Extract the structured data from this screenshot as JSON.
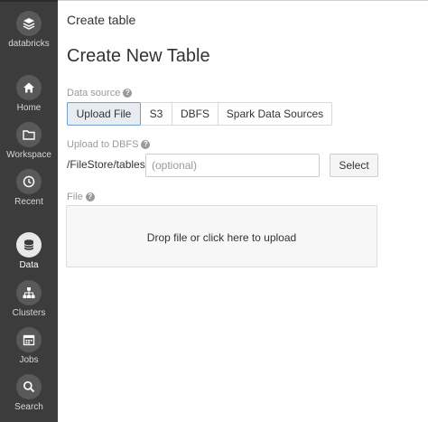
{
  "sidebar": {
    "brand": {
      "label": "databricks",
      "icon": "databricks-logo-icon"
    },
    "items": [
      {
        "label": "Home",
        "icon": "home-icon"
      },
      {
        "label": "Workspace",
        "icon": "folder-icon"
      },
      {
        "label": "Recent",
        "icon": "clock-icon"
      },
      {
        "label": "Data",
        "icon": "database-icon",
        "active": true
      },
      {
        "label": "Clusters",
        "icon": "clusters-icon"
      },
      {
        "label": "Jobs",
        "icon": "calendar-icon"
      },
      {
        "label": "Search",
        "icon": "search-icon"
      }
    ]
  },
  "main": {
    "page_title": "Create table",
    "heading": "Create New Table",
    "data_source": {
      "label": "Data source",
      "options": [
        "Upload File",
        "S3",
        "DBFS",
        "Spark Data Sources"
      ],
      "selected": "Upload File"
    },
    "upload": {
      "label": "Upload to DBFS",
      "path_prefix": "/FileStore/tables/",
      "input_value": "",
      "input_placeholder": "(optional)",
      "select_label": "Select"
    },
    "file": {
      "label": "File",
      "dropzone_text": "Drop file or click here to upload"
    }
  },
  "colors": {
    "sidebar_bg": "#3c3c3c",
    "active_segment_border": "#6f9ed1",
    "active_segment_bg": "#e6ecf1",
    "label_gray": "#9a9a9a"
  }
}
